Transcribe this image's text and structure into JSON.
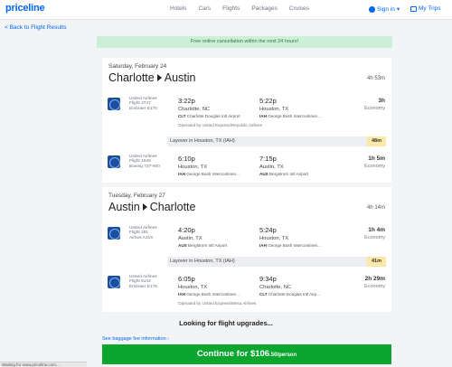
{
  "header": {
    "logo": "priceline",
    "nav": [
      "Hotels",
      "Cars",
      "Flights",
      "Packages",
      "Cruises"
    ],
    "sign_in": "Sign in",
    "my_trips": "My Trips"
  },
  "back_link": "< Back to Flight Results",
  "notice": "Free online cancellation within the next 24 hours!",
  "trips": [
    {
      "date": "Saturday, February 24",
      "from": "Charlotte",
      "to": "Austin",
      "duration": "4h 53m",
      "segments": [
        {
          "airline": "United Airlines",
          "flight": "Flight 3747",
          "aircraft": "Embraer E170",
          "dep_time": "3:22p",
          "dep_city": "Charlotte, NC",
          "dep_code": "CLT",
          "dep_airport": "Charlotte Douglas Intl Airport",
          "arr_time": "5:22p",
          "arr_city": "Houston, TX",
          "arr_code": "IAH",
          "arr_airport": "George Bush Intercontinen...",
          "seg_duration": "3h",
          "cabin": "Economy",
          "operated_by": "Operated by United Express/Republic Airlines"
        },
        {
          "airline": "United Airlines",
          "flight": "Flight 1045",
          "aircraft": "Boeing 737-900",
          "dep_time": "6:10p",
          "dep_city": "Houston, TX",
          "dep_code": "IAH",
          "dep_airport": "George Bush Intercontinen...",
          "arr_time": "7:15p",
          "arr_city": "Austin, TX",
          "arr_code": "AUS",
          "arr_airport": "Bergstrom Intl Airport",
          "seg_duration": "1h 5m",
          "cabin": "Economy",
          "operated_by": ""
        }
      ],
      "layover": {
        "text": "Layover in Houston, TX (IAH)",
        "time": "48m"
      }
    },
    {
      "date": "Tuesday, February 27",
      "from": "Austin",
      "to": "Charlotte",
      "duration": "4h 14m",
      "segments": [
        {
          "airline": "United Airlines",
          "flight": "Flight 281",
          "aircraft": "Airbus A319",
          "dep_time": "4:20p",
          "dep_city": "Austin, TX",
          "dep_code": "AUS",
          "dep_airport": "Bergstrom Intl Airport",
          "arr_time": "5:24p",
          "arr_city": "Houston, TX",
          "arr_code": "IAH",
          "arr_airport": "George Bush Intercontinen...",
          "seg_duration": "1h 4m",
          "cabin": "Economy",
          "operated_by": ""
        },
        {
          "airline": "United Airlines",
          "flight": "Flight 6142",
          "aircraft": "Embraer E175",
          "dep_time": "6:05p",
          "dep_city": "Houston, TX",
          "dep_code": "IAH",
          "dep_airport": "George Bush Intercontinen...",
          "arr_time": "9:34p",
          "arr_city": "Charlotte, NC",
          "arr_code": "CLT",
          "arr_airport": "Charlotte Douglas Intl Airp...",
          "seg_duration": "2h 29m",
          "cabin": "Economy",
          "operated_by": "Operated by United Express/Mesa Airlines"
        }
      ],
      "layover": {
        "text": "Layover in Houston, TX (IAH)",
        "time": "41m"
      }
    }
  ],
  "upgrades": "Looking for flight upgrades...",
  "baggage_link": "See baggage fee information",
  "continue": {
    "prefix": "Continue for $106",
    "cents": ".50/person"
  },
  "status_bar": "Waiting for www.priceline.com...",
  "colors": {
    "brand": "#0068ef",
    "continue": "#0aa62e",
    "notice_bg": "#cdeed7",
    "layover_badge": "#fce9a8"
  }
}
